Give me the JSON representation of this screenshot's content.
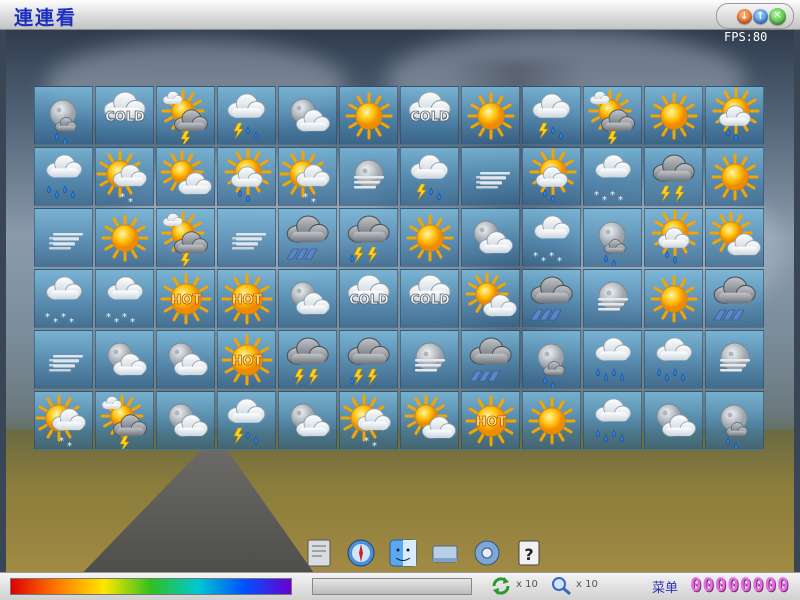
{
  "window": {
    "title": "連連看"
  },
  "hud": {
    "fps": "FPS:80"
  },
  "board": {
    "rows": [
      [
        "moon-snow",
        "cold",
        "sun-thunderstorm",
        "thunderstorm",
        "moon-cloud",
        "sun",
        "cold",
        "sun",
        "thunderstorm",
        "sun-thunderstorm",
        "sun",
        "sun-shower"
      ],
      [
        "rain",
        "sun-snow",
        "sun-cloud",
        "sun-shower",
        "sun-snow",
        "moon-fog",
        "thunderstorm",
        "fog",
        "sun-shower",
        "snow",
        "lightning",
        "sun"
      ],
      [
        "fog",
        "sun",
        "sun-thunderstorm",
        "fog",
        "hail",
        "lightning-rain",
        "sun",
        "moon-cloud",
        "snow",
        "moon-snow",
        "sun-shower",
        "sun-cloud"
      ],
      [
        "snow",
        "snow",
        "hot",
        "hot",
        "moon-cloud",
        "cold",
        "cold",
        "sun-cloud",
        "hail",
        "moon-fog",
        "sun",
        "hail"
      ],
      [
        "fog",
        "moon-cloud",
        "moon-cloud",
        "hot",
        "lightning",
        "lightning-rain",
        "moon-fog",
        "hail",
        "moon-snow",
        "rain",
        "rain",
        "moon-fog"
      ],
      [
        "sun-snow",
        "sun-thunderstorm",
        "moon-cloud",
        "thunderstorm",
        "moon-cloud",
        "sun-snow",
        "sun-cloud",
        "hot",
        "sun",
        "rain",
        "moon-cloud",
        "moon-snow"
      ]
    ],
    "labels": {
      "cold": "COLD",
      "hot": "HOT"
    }
  },
  "dock": [
    {
      "name": "notes-dock-icon"
    },
    {
      "name": "safari-dock-icon"
    },
    {
      "name": "finder-dock-icon"
    },
    {
      "name": "drive-dock-icon"
    },
    {
      "name": "settings-dock-icon"
    },
    {
      "name": "help-dock-icon"
    }
  ],
  "status": {
    "refresh_count": "x 10",
    "hint_count": "x 10",
    "menu_label": "菜单",
    "score": "00000000"
  },
  "colors": {
    "title": "#1a2fbf",
    "score": "#e46ce0",
    "menu": "#2a35b0"
  }
}
